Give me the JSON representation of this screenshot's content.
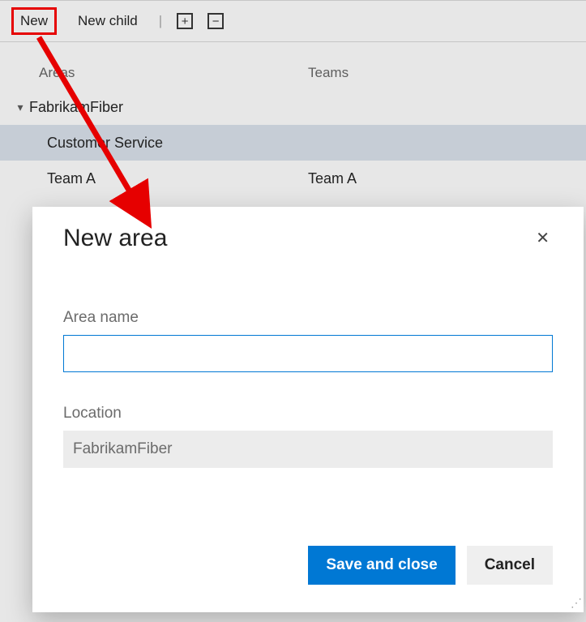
{
  "toolbar": {
    "new_label": "New",
    "new_child_label": "New child"
  },
  "columns": {
    "areas_header": "Areas",
    "teams_header": "Teams"
  },
  "tree": {
    "root_label": "FabrikamFiber",
    "rows": [
      {
        "area": "Customer Service",
        "team": ""
      },
      {
        "area": "Team A",
        "team": "Team A"
      }
    ]
  },
  "dialog": {
    "title": "New area",
    "area_name_label": "Area name",
    "area_name_value": "",
    "location_label": "Location",
    "location_value": "FabrikamFiber",
    "save_label": "Save and close",
    "cancel_label": "Cancel"
  },
  "colors": {
    "accent": "#0078d4",
    "annotation": "#e60000"
  }
}
